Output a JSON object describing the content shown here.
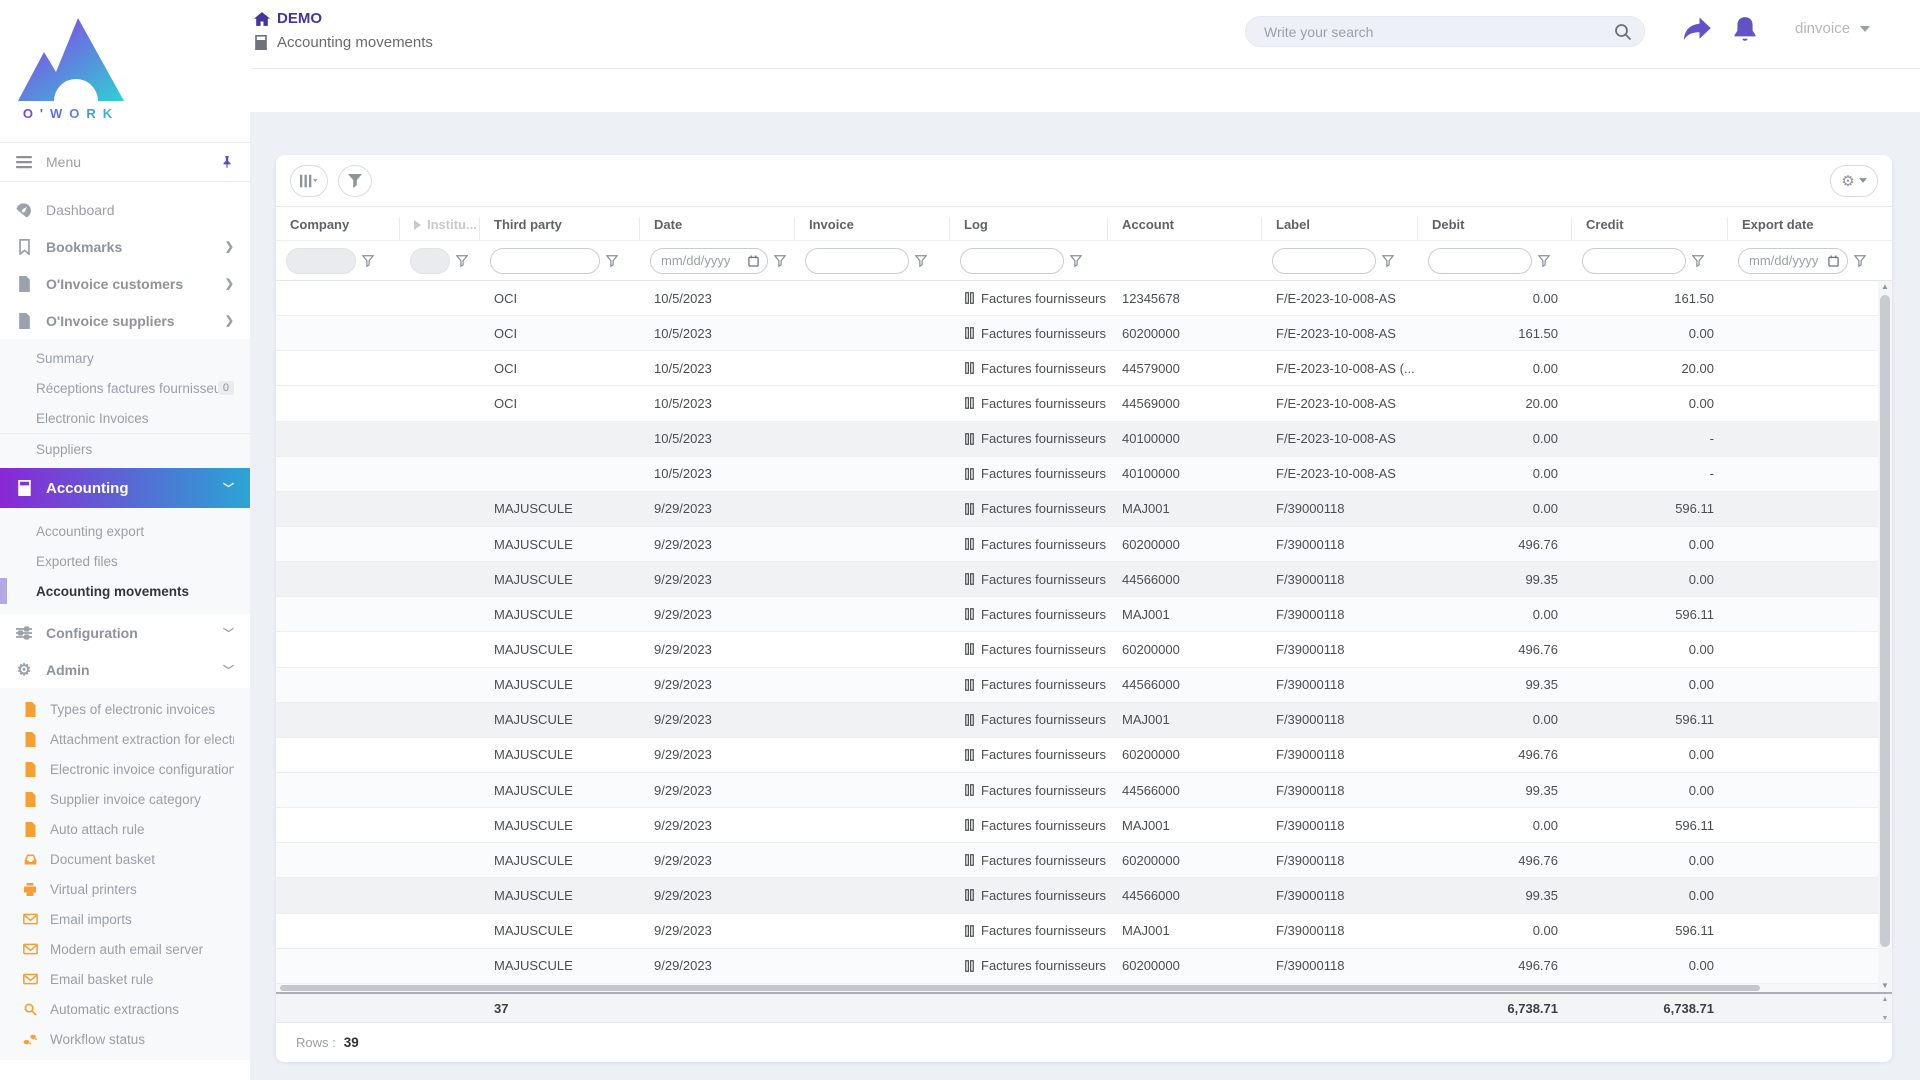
{
  "brand": {
    "name": "O'WORK",
    "gradient_from": "#7b3bf2",
    "gradient_to": "#28c9d6"
  },
  "colors": {
    "accent_purple": "#5b4ccc",
    "demo_purple": "#4334a0",
    "admin_orange": "#f5a033",
    "accounting_gradient_from": "#8a27d6",
    "accounting_gradient_to": "#2aa5d4"
  },
  "header": {
    "app_title": "DEMO",
    "page_title": "Accounting movements",
    "search_placeholder": "Write your search",
    "user_name": "dinvoice"
  },
  "sidebar": {
    "menu_label": "Menu",
    "items": [
      {
        "label": "Dashboard"
      },
      {
        "label": "Bookmarks"
      },
      {
        "label": "O'Invoice customers"
      },
      {
        "label": "O'Invoice suppliers"
      }
    ],
    "suppliers_submenu": [
      {
        "label": "Summary"
      },
      {
        "label": "Réceptions factures fournisseurs",
        "badge": "0"
      },
      {
        "label": "Electronic Invoices"
      },
      {
        "label": "Suppliers"
      }
    ],
    "accounting_label": "Accounting",
    "accounting_submenu": [
      {
        "label": "Accounting export"
      },
      {
        "label": "Exported files"
      },
      {
        "label": "Accounting movements",
        "active": true
      }
    ],
    "configuration_label": "Configuration",
    "admin_label": "Admin",
    "admin_submenu": [
      "Types of electronic invoices",
      "Attachment extraction for electroni",
      "Electronic invoice configuration",
      "Supplier invoice category",
      "Auto attach rule",
      "Document basket",
      "Virtual printers",
      "Email imports",
      "Modern auth email server",
      "Email basket rule",
      "Automatic extractions",
      "Workflow status"
    ]
  },
  "table": {
    "columns": [
      "Company",
      "Institu...",
      "Third party",
      "Date",
      "Invoice",
      "Log",
      "Account",
      "Label",
      "Debit",
      "Credit",
      "Export date"
    ],
    "date_placeholder": "mm/dd/yyyy",
    "rows": [
      {
        "company": "",
        "institution": "",
        "third_party": "OCI",
        "date": "10/5/2023",
        "invoice": "",
        "log": "Factures fournisseurs",
        "account": "12345678",
        "label": "F/E-2023-10-008-AS",
        "debit": "0.00",
        "credit": "161.50",
        "export_date": "",
        "shade": 0
      },
      {
        "company": "",
        "institution": "",
        "third_party": "OCI",
        "date": "10/5/2023",
        "invoice": "",
        "log": "Factures fournisseurs",
        "account": "60200000",
        "label": "F/E-2023-10-008-AS",
        "debit": "161.50",
        "credit": "0.00",
        "export_date": "",
        "shade": 1
      },
      {
        "company": "",
        "institution": "",
        "third_party": "OCI",
        "date": "10/5/2023",
        "invoice": "",
        "log": "Factures fournisseurs",
        "account": "44579000",
        "label": "F/E-2023-10-008-AS (...",
        "debit": "0.00",
        "credit": "20.00",
        "export_date": "",
        "shade": 0
      },
      {
        "company": "",
        "institution": "",
        "third_party": "OCI",
        "date": "10/5/2023",
        "invoice": "",
        "log": "Factures fournisseurs",
        "account": "44569000",
        "label": "F/E-2023-10-008-AS",
        "debit": "20.00",
        "credit": "0.00",
        "export_date": "",
        "shade": 0
      },
      {
        "company": "",
        "institution": "",
        "third_party": "",
        "date": "10/5/2023",
        "invoice": "",
        "log": "Factures fournisseurs",
        "account": "40100000",
        "label": "F/E-2023-10-008-AS",
        "debit": "0.00",
        "credit": "-",
        "export_date": "",
        "shade": 2
      },
      {
        "company": "",
        "institution": "",
        "third_party": "",
        "date": "10/5/2023",
        "invoice": "",
        "log": "Factures fournisseurs",
        "account": "40100000",
        "label": "F/E-2023-10-008-AS",
        "debit": "0.00",
        "credit": "-",
        "export_date": "",
        "shade": 1
      },
      {
        "company": "",
        "institution": "",
        "third_party": "MAJUSCULE",
        "date": "9/29/2023",
        "invoice": "",
        "log": "Factures fournisseurs",
        "account": "MAJ001",
        "label": "F/39000118",
        "debit": "0.00",
        "credit": "596.11",
        "export_date": "",
        "shade": 2
      },
      {
        "company": "",
        "institution": "",
        "third_party": "MAJUSCULE",
        "date": "9/29/2023",
        "invoice": "",
        "log": "Factures fournisseurs",
        "account": "60200000",
        "label": "F/39000118",
        "debit": "496.76",
        "credit": "0.00",
        "export_date": "",
        "shade": 1
      },
      {
        "company": "",
        "institution": "",
        "third_party": "MAJUSCULE",
        "date": "9/29/2023",
        "invoice": "",
        "log": "Factures fournisseurs",
        "account": "44566000",
        "label": "F/39000118",
        "debit": "99.35",
        "credit": "0.00",
        "export_date": "",
        "shade": 2
      },
      {
        "company": "",
        "institution": "",
        "third_party": "MAJUSCULE",
        "date": "9/29/2023",
        "invoice": "",
        "log": "Factures fournisseurs",
        "account": "MAJ001",
        "label": "F/39000118",
        "debit": "0.00",
        "credit": "596.11",
        "export_date": "",
        "shade": 1
      },
      {
        "company": "",
        "institution": "",
        "third_party": "MAJUSCULE",
        "date": "9/29/2023",
        "invoice": "",
        "log": "Factures fournisseurs",
        "account": "60200000",
        "label": "F/39000118",
        "debit": "496.76",
        "credit": "0.00",
        "export_date": "",
        "shade": 0
      },
      {
        "company": "",
        "institution": "",
        "third_party": "MAJUSCULE",
        "date": "9/29/2023",
        "invoice": "",
        "log": "Factures fournisseurs",
        "account": "44566000",
        "label": "F/39000118",
        "debit": "99.35",
        "credit": "0.00",
        "export_date": "",
        "shade": 1
      },
      {
        "company": "",
        "institution": "",
        "third_party": "MAJUSCULE",
        "date": "9/29/2023",
        "invoice": "",
        "log": "Factures fournisseurs",
        "account": "MAJ001",
        "label": "F/39000118",
        "debit": "0.00",
        "credit": "596.11",
        "export_date": "",
        "shade": 2
      },
      {
        "company": "",
        "institution": "",
        "third_party": "MAJUSCULE",
        "date": "9/29/2023",
        "invoice": "",
        "log": "Factures fournisseurs",
        "account": "60200000",
        "label": "F/39000118",
        "debit": "496.76",
        "credit": "0.00",
        "export_date": "",
        "shade": 0
      },
      {
        "company": "",
        "institution": "",
        "third_party": "MAJUSCULE",
        "date": "9/29/2023",
        "invoice": "",
        "log": "Factures fournisseurs",
        "account": "44566000",
        "label": "F/39000118",
        "debit": "99.35",
        "credit": "0.00",
        "export_date": "",
        "shade": 1
      },
      {
        "company": "",
        "institution": "",
        "third_party": "MAJUSCULE",
        "date": "9/29/2023",
        "invoice": "",
        "log": "Factures fournisseurs",
        "account": "MAJ001",
        "label": "F/39000118",
        "debit": "0.00",
        "credit": "596.11",
        "export_date": "",
        "shade": 0
      },
      {
        "company": "",
        "institution": "",
        "third_party": "MAJUSCULE",
        "date": "9/29/2023",
        "invoice": "",
        "log": "Factures fournisseurs",
        "account": "60200000",
        "label": "F/39000118",
        "debit": "496.76",
        "credit": "0.00",
        "export_date": "",
        "shade": 1
      },
      {
        "company": "",
        "institution": "",
        "third_party": "MAJUSCULE",
        "date": "9/29/2023",
        "invoice": "",
        "log": "Factures fournisseurs",
        "account": "44566000",
        "label": "F/39000118",
        "debit": "99.35",
        "credit": "0.00",
        "export_date": "",
        "shade": 2
      },
      {
        "company": "",
        "institution": "",
        "third_party": "MAJUSCULE",
        "date": "9/29/2023",
        "invoice": "",
        "log": "Factures fournisseurs",
        "account": "MAJ001",
        "label": "F/39000118",
        "debit": "0.00",
        "credit": "596.11",
        "export_date": "",
        "shade": 0
      },
      {
        "company": "",
        "institution": "",
        "third_party": "MAJUSCULE",
        "date": "9/29/2023",
        "invoice": "",
        "log": "Factures fournisseurs",
        "account": "60200000",
        "label": "F/39000118",
        "debit": "496.76",
        "credit": "0.00",
        "export_date": "",
        "shade": 1
      }
    ],
    "totals": {
      "count": "37",
      "debit": "6,738.71",
      "credit": "6,738.71"
    },
    "rows_label": "Rows :",
    "rows_count": "39"
  }
}
